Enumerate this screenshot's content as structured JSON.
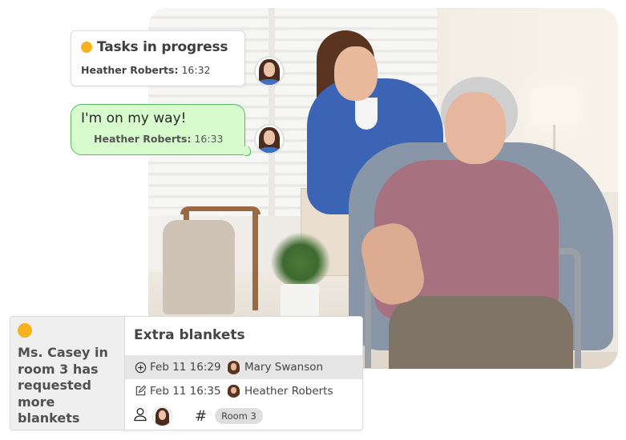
{
  "photo": {
    "alt": "Nurse assisting smiling elderly woman in wheelchair"
  },
  "tasks_card": {
    "status_color": "#f7b21e",
    "title": "Tasks in progress",
    "author": "Heather Roberts",
    "separator": ":",
    "time": "16:32"
  },
  "chat_bubble": {
    "message": "I'm on my way!",
    "author": "Heather Roberts:",
    "time": "16:33",
    "bubble_color": "#d8fbcd",
    "border_color": "#59b865"
  },
  "request_card": {
    "status_color": "#f7b21e",
    "description": "Ms. Casey in room 3 has requested more blankets",
    "title": "Extra blankets",
    "created": {
      "icon": "plus-circle-icon",
      "date": "Feb 11 16:29",
      "user": "Mary Swanson"
    },
    "edited": {
      "icon": "edit-icon",
      "date": "Feb 11 16:35",
      "user": "Heather Roberts"
    },
    "assignee_icon": "person-icon",
    "tag_icon": "hash-icon",
    "hash_symbol": "#",
    "tag": "Room 3"
  }
}
